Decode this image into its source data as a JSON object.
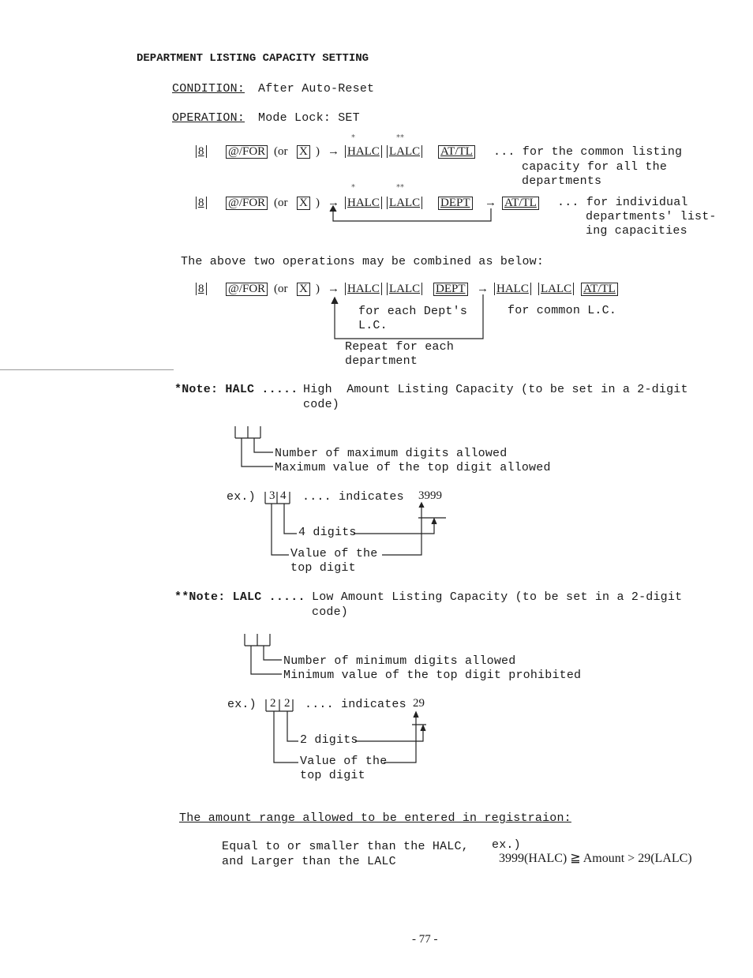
{
  "heading": "DEPARTMENT LISTING CAPACITY SETTING",
  "condition": {
    "label": "CONDITION:",
    "value": "After Auto-Reset"
  },
  "operation": {
    "label": "OPERATION:",
    "value": "Mode Lock: SET"
  },
  "keys": {
    "eight": "8",
    "at_for": "@/FOR",
    "or_open": "(or",
    "x": "X",
    "close": ")",
    "halc": "HALC",
    "lalc": "LALC",
    "at_tl": "AT/TL",
    "dept": "DEPT",
    "arrow": "→",
    "star1": "*",
    "star2": "**"
  },
  "op1": {
    "desc": [
      "... for the common listing",
      "capacity for all the",
      "departments"
    ]
  },
  "op2": {
    "desc": [
      "... for individual",
      "departments' list-",
      "ing capacities"
    ]
  },
  "combined": {
    "intro": "The above two operations may be combined as below:",
    "loop_note": [
      "for each Dept's",
      "L.C."
    ],
    "common_note": "for common L.C.",
    "repeat_note": [
      "Repeat for each",
      "department"
    ]
  },
  "note_halc": {
    "prefix": "*Note:",
    "term": "HALC .....",
    "text": [
      "High  Amount Listing Capacity (to be set in a 2-digit",
      "code)"
    ],
    "legend": [
      "Number of maximum digits allowed",
      "Maximum value of the top digit allowed"
    ],
    "example": {
      "label": "ex.)",
      "digits": [
        "3",
        "4"
      ],
      "indicates": ".... indicates",
      "result": "3999",
      "digits_label": "4 digits",
      "value_label": [
        "Value of the",
        "top digit"
      ]
    }
  },
  "note_lalc": {
    "prefix": "**Note:",
    "term": "LALC .....",
    "text": [
      "Low Amount Listing Capacity (to be set in a 2-digit",
      "code)"
    ],
    "legend": [
      "Number of minimum digits allowed",
      "Minimum value of the top digit prohibited"
    ],
    "example": {
      "label": "ex.)",
      "digits": [
        "2",
        "2"
      ],
      "indicates": ".... indicates",
      "result": "29",
      "digits_label": "2 digits",
      "value_label": [
        "Value of the",
        "top digit"
      ]
    }
  },
  "range": {
    "heading": "The amount range allowed to be entered in registraion:",
    "rule": [
      "Equal to or smaller than the HALC,",
      "and Larger than the LALC"
    ],
    "example_label": "ex.)",
    "example": "3999(HALC) ≧ Amount > 29(LALC)"
  },
  "page_number": "- 77 -"
}
